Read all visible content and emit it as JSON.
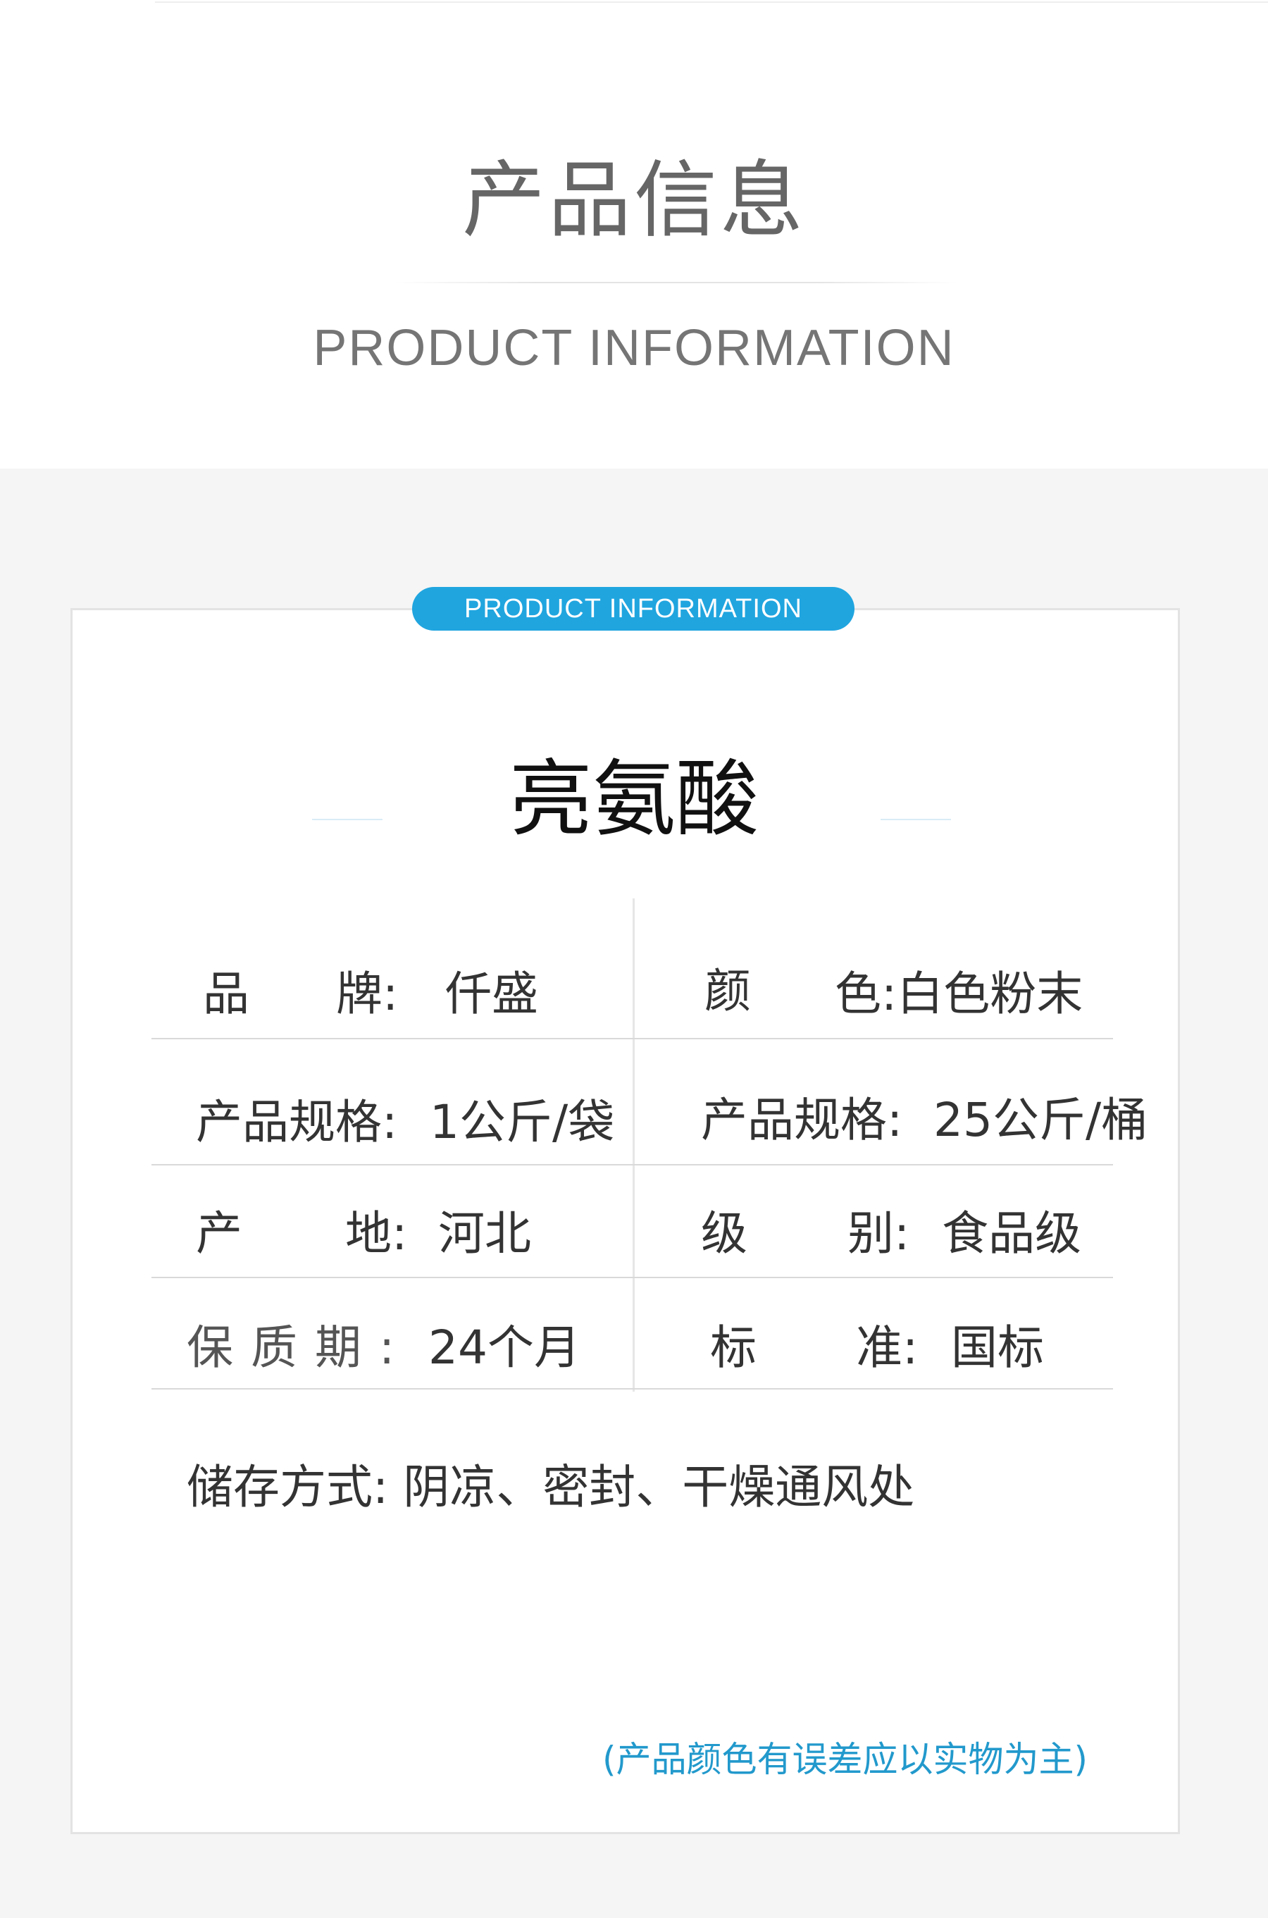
{
  "header": {
    "title_cn": "产品信息",
    "title_en": "PRODUCT INFORMATION"
  },
  "card": {
    "badge": "PRODUCT INFORMATION",
    "product_name": "亮氨酸",
    "rows": [
      {
        "left": [
          "品",
          "牌:",
          "仟盛"
        ],
        "right": [
          "颜",
          "色:白色粉末"
        ]
      },
      {
        "left": [
          "产品规格:",
          "1公斤/袋"
        ],
        "right": [
          "产品规格:",
          "25公斤/桶"
        ]
      },
      {
        "left": [
          "产",
          "地:",
          "河北"
        ],
        "right": [
          "级",
          "别:",
          "食品级"
        ]
      },
      {
        "left": [
          "保 质 期 :",
          "24个月"
        ],
        "right": [
          "标",
          "准:",
          "国标"
        ]
      }
    ],
    "storage": "储存方式:  阴凉、密封、干燥通风处",
    "note": "(产品颜色有误差应以实物为主)"
  }
}
